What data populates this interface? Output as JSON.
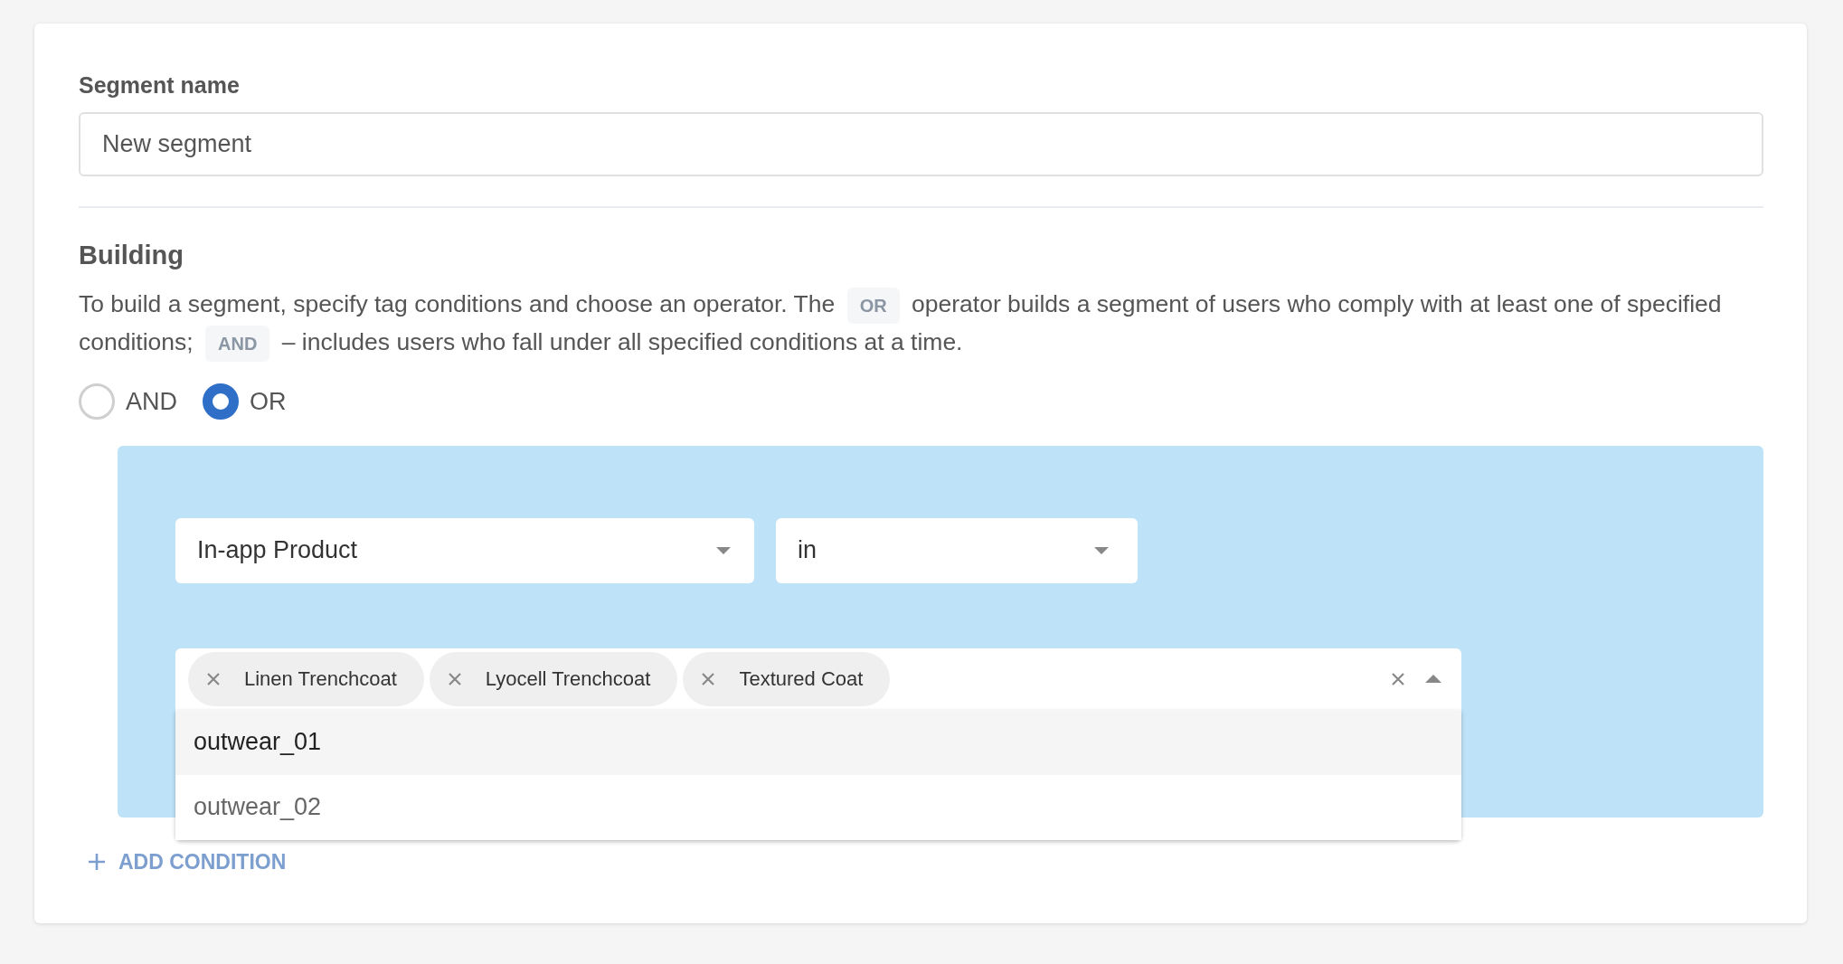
{
  "segment_name": {
    "label": "Segment name",
    "value": "New segment"
  },
  "building": {
    "title": "Building",
    "description": [
      {
        "kind": "text",
        "text": "To build a segment, specify tag conditions and choose an operator. The "
      },
      {
        "kind": "code",
        "text": "OR"
      },
      {
        "kind": "text",
        "text": " operator builds a segment of users who comply with at least one of specified conditions; "
      },
      {
        "kind": "code",
        "text": "AND"
      },
      {
        "kind": "text",
        "text": " – includes users who fall under all specified conditions at a time."
      }
    ],
    "operators": [
      {
        "label": "AND",
        "selected": false
      },
      {
        "label": "OR",
        "selected": true
      }
    ]
  },
  "condition": {
    "tag_select": {
      "value": "In-app Product"
    },
    "operator_select": {
      "value": "in"
    },
    "values": {
      "chips": [
        "Linen Trenchcoat",
        "Lyocell Trenchcoat",
        "Textured Coat"
      ],
      "expanded": true,
      "options": [
        {
          "label": "outwear_01",
          "highlighted": true
        },
        {
          "label": "outwear_02",
          "highlighted": false
        }
      ]
    }
  },
  "add_condition": "ADD CONDITION"
}
